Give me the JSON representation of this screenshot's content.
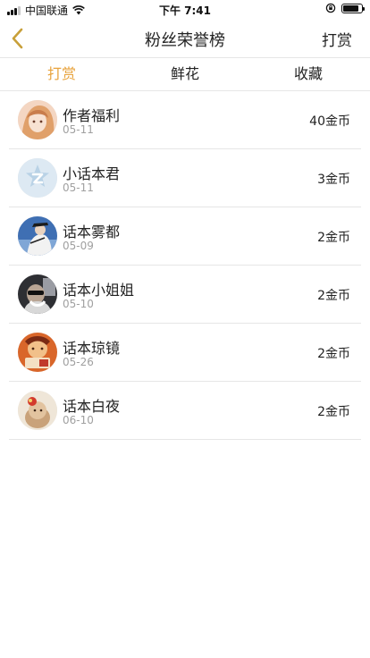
{
  "status_bar": {
    "carrier": "中国联通",
    "time": "下午 7:41",
    "battery_level": 0.85
  },
  "nav": {
    "title": "粉丝荣誉榜",
    "action_label": "打赏",
    "back_icon": "chevron-left-icon"
  },
  "tabs": [
    {
      "label": "打赏",
      "active": true
    },
    {
      "label": "鲜花",
      "active": false
    },
    {
      "label": "收藏",
      "active": false
    }
  ],
  "fans": [
    {
      "name": "作者福利",
      "date": "05-11",
      "amount": "40金币"
    },
    {
      "name": "小话本君",
      "date": "05-11",
      "amount": "3金币"
    },
    {
      "name": "话本雾都",
      "date": "05-09",
      "amount": "2金币"
    },
    {
      "name": "话本小姐姐",
      "date": "05-10",
      "amount": "2金币"
    },
    {
      "name": "话本琼镜",
      "date": "05-26",
      "amount": "2金币"
    },
    {
      "name": "话本白夜",
      "date": "06-10",
      "amount": "2金币"
    }
  ],
  "colors": {
    "accent": "#e8a33d",
    "divider": "#e6e6e6",
    "secondary_text": "#a0a0a0"
  }
}
